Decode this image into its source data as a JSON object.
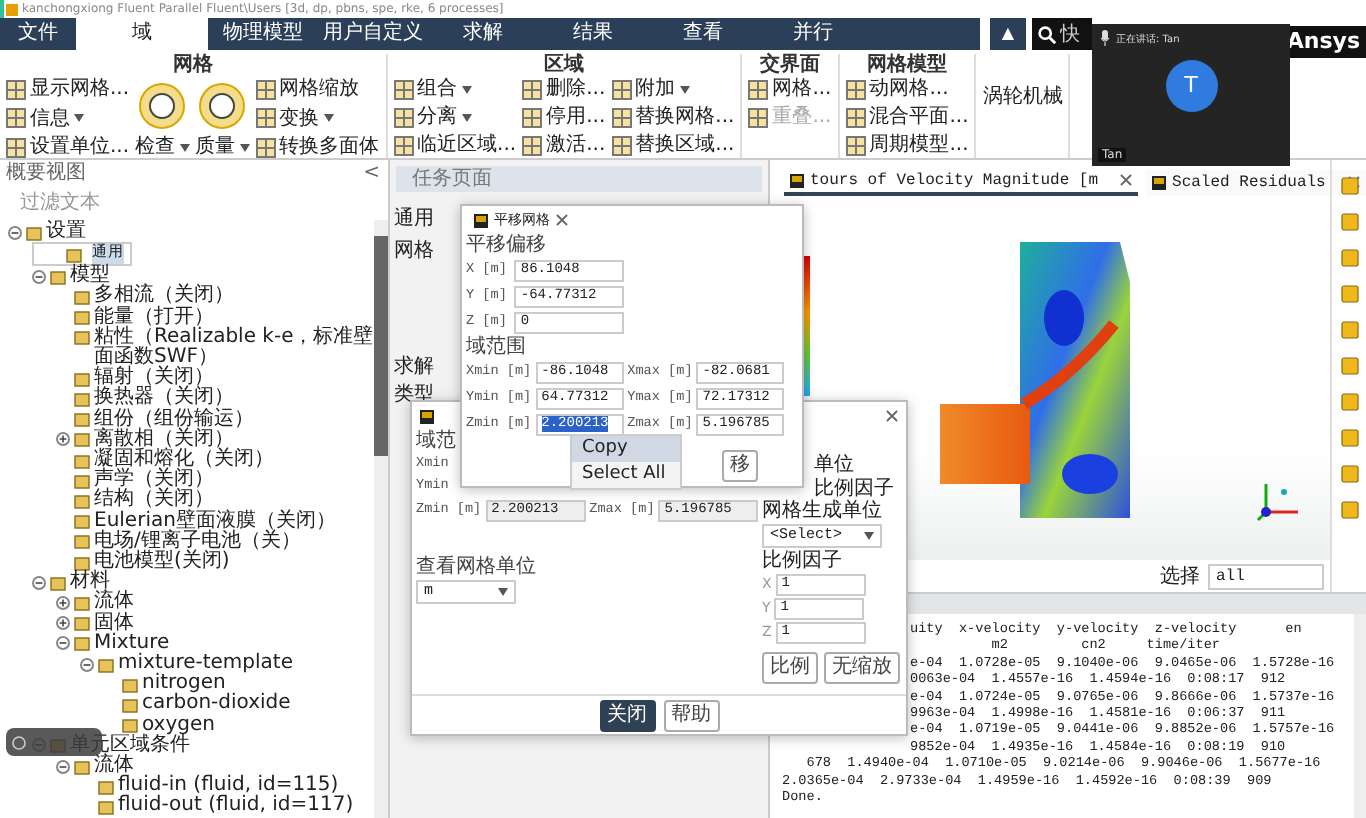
{
  "window": {
    "title": "kanchongxiong Fluent Parallel Fluent\\Users [3d, dp, pbns, spe, rke, 6 processes]"
  },
  "ribbon_tabs": [
    {
      "label": "文件",
      "kind": "file",
      "selected": false
    },
    {
      "label": "域",
      "kind": "tab",
      "selected": true
    },
    {
      "label": "物理模型",
      "kind": "tab",
      "selected": false
    },
    {
      "label": "用户自定义",
      "kind": "tab",
      "selected": false
    },
    {
      "label": "求解",
      "kind": "tab",
      "selected": false
    },
    {
      "label": "结果",
      "kind": "tab",
      "selected": false
    },
    {
      "label": "查看",
      "kind": "tab",
      "selected": false
    },
    {
      "label": "并行",
      "kind": "tab",
      "selected": false
    }
  ],
  "ribbon_collapse": "▲",
  "search": {
    "placeholder": "快"
  },
  "ribbon_groups": [
    {
      "title": "网格",
      "columns": [
        [
          {
            "label": "显示网格...",
            "kind": "small"
          },
          {
            "label": "信息",
            "kind": "small",
            "dropdown": true
          },
          {
            "label": "设置单位...",
            "kind": "small"
          }
        ],
        [
          {
            "label": "检查",
            "kind": "large",
            "dropdown": true
          }
        ],
        [
          {
            "label": "质量",
            "kind": "large",
            "dropdown": true
          }
        ],
        [
          {
            "label": "网格缩放",
            "kind": "small"
          },
          {
            "label": "变换",
            "kind": "small",
            "dropdown": true
          },
          {
            "label": "转换多面体",
            "kind": "small"
          }
        ]
      ]
    },
    {
      "title": "区域",
      "columns": [
        [
          {
            "label": "组合",
            "kind": "small",
            "dropdown": true
          },
          {
            "label": "分离",
            "kind": "small",
            "dropdown": true
          },
          {
            "label": "临近区域...",
            "kind": "small"
          }
        ],
        [
          {
            "label": "删除...",
            "kind": "small"
          },
          {
            "label": "停用...",
            "kind": "small"
          },
          {
            "label": "激活...",
            "kind": "small"
          }
        ],
        [
          {
            "label": "附加",
            "kind": "small",
            "dropdown": true
          },
          {
            "label": "替换网格...",
            "kind": "small"
          },
          {
            "label": "替换区域...",
            "kind": "small"
          }
        ]
      ]
    },
    {
      "title": "交界面",
      "columns": [
        [
          {
            "label": "网格...",
            "kind": "small"
          },
          {
            "label": "重叠...",
            "kind": "small",
            "disabled": true
          }
        ]
      ]
    },
    {
      "title": "网格模型",
      "columns": [
        [
          {
            "label": "动网格...",
            "kind": "small"
          },
          {
            "label": "混合平面...",
            "kind": "small"
          },
          {
            "label": "周期模型...",
            "kind": "small"
          }
        ]
      ]
    },
    {
      "columns": [
        [
          {
            "label": "涡轮机械",
            "kind": "text"
          }
        ]
      ]
    }
  ],
  "logo": "Ansys",
  "meeting": {
    "speaker": "正在讲话: Tan",
    "avatar": "T",
    "name": "Tan"
  },
  "outline": {
    "title": "概要视图",
    "collapse": "<",
    "filter": {
      "placeholder": "过滤文本"
    },
    "tree": [
      {
        "label": "设置",
        "expanded": true,
        "selected": false,
        "children": [
          {
            "label": "通用",
            "selected": true
          },
          {
            "label": "模型",
            "expanded": true,
            "selected": false,
            "children": [
              {
                "label": "多相流（关闭）",
                "selected": false
              },
              {
                "label": "能量（打开）",
                "selected": false
              },
              {
                "label": "粘性（Realizable k-e，标准壁面函数SWF）",
                "selected": false
              },
              {
                "label": "辐射（关闭）",
                "selected": false
              },
              {
                "label": "换热器（关闭）",
                "selected": false
              },
              {
                "label": "组份（组份输运）",
                "selected": false
              },
              {
                "label": "离散相（关闭）",
                "expanded": false,
                "selected": false
              },
              {
                "label": "凝固和熔化（关闭）",
                "selected": false
              },
              {
                "label": "声学（关闭）",
                "selected": false
              },
              {
                "label": "结构（关闭）",
                "selected": false
              },
              {
                "label": "Eulerian壁面液膜（关闭）",
                "selected": false
              },
              {
                "label": "电场/锂离子电池（关）",
                "selected": false
              },
              {
                "label": "电池模型(关闭)",
                "selected": false
              }
            ]
          },
          {
            "label": "材料",
            "expanded": true,
            "selected": false,
            "children": [
              {
                "label": "流体",
                "expanded": false,
                "selected": false
              },
              {
                "label": "固体",
                "expanded": false,
                "selected": false
              },
              {
                "label": "Mixture",
                "expanded": true,
                "selected": false,
                "children": [
                  {
                    "label": "mixture-template",
                    "expanded": true,
                    "selected": false,
                    "children": [
                      {
                        "label": "nitrogen",
                        "selected": false
                      },
                      {
                        "label": "carbon-dioxide",
                        "selected": false
                      },
                      {
                        "label": "oxygen",
                        "selected": false
                      }
                    ]
                  }
                ]
              }
            ]
          },
          {
            "label": "单元区域条件",
            "expanded": true,
            "selected": false,
            "children": [
              {
                "label": "流体",
                "expanded": true,
                "selected": false,
                "children": [
                  {
                    "label": "fluid-in (fluid, id=115)",
                    "selected": false
                  },
                  {
                    "label": "fluid-out (fluid, id=117)",
                    "selected": false
                  }
                ]
              }
            ]
          }
        ]
      }
    ]
  },
  "task_page": {
    "title": "任务页面",
    "labels": [
      "通用",
      "网格",
      "求解",
      "类型"
    ]
  },
  "graphics_tabs": [
    {
      "label": "tours of Velocity Magnitude [m",
      "selected": true
    },
    {
      "label": "Scaled Residuals",
      "selected": false
    }
  ],
  "graphics_select": {
    "label": "选择",
    "value": "all"
  },
  "console": {
    "lines": [
      {
        "kind": "clipped",
        "text": "uity  x-velocity  y-velocity  z-velocity      en"
      },
      {
        "kind": "clipped",
        "text": "          m2         cn2     time/iter"
      },
      {
        "kind": "clipped",
        "text": "e-04  1.0728e-05  9.1040e-06  9.0465e-06  1.5728e-16"
      },
      {
        "kind": "clipped",
        "text": "0063e-04  1.4557e-16  1.4594e-16  0:08:17  912"
      },
      {
        "kind": "clipped",
        "text": "e-04  1.0724e-05  9.0765e-06  9.8666e-06  1.5737e-16"
      },
      {
        "kind": "clipped",
        "text": "9963e-04  1.4998e-16  1.4581e-16  0:06:37  911"
      },
      {
        "kind": "clipped",
        "text": "e-04  1.0719e-05  9.0441e-06  9.8852e-06  1.5757e-16"
      },
      {
        "kind": "clipped",
        "text": "9852e-04  1.4935e-16  1.4584e-16  0:08:19  910"
      },
      {
        "kind": "full",
        "text": "   678  1.4940e-04  1.0710e-05  9.0214e-06  9.9046e-06  1.5677e-16"
      },
      {
        "kind": "full",
        "text": "2.0365e-04  2.9733e-04  1.4959e-16  1.4592e-16  0:08:39  909"
      },
      {
        "kind": "full",
        "text": "Done."
      }
    ]
  },
  "scale_dialog": {
    "range_label": "域范",
    "row_labels": [
      "Xmin",
      "Ymin"
    ],
    "zrow": {
      "min_label": "Zmin [m]",
      "min": "2.200213",
      "max_label": "Zmax [m]",
      "max": "5.196785"
    },
    "view_units": {
      "label": "查看网格单位",
      "value": "m"
    },
    "right": {
      "line1": "单位",
      "line2": "比例因子",
      "mesh_units": "网格生成单位",
      "mesh_units_value": "<Select>",
      "factor_label": "比例因子",
      "factors": [
        {
          "axis": "X",
          "value": "1"
        },
        {
          "axis": "Y",
          "value": "1"
        },
        {
          "axis": "Z",
          "value": "1"
        }
      ],
      "buttons": [
        "比例",
        "无缩放"
      ]
    },
    "buttons": [
      {
        "label": "关闭",
        "kind": "primary"
      },
      {
        "label": "帮助",
        "kind": "normal"
      }
    ]
  },
  "translate_dialog": {
    "title": "平移网格",
    "offset_label": "平移偏移",
    "offsets": [
      {
        "label": "X [m]",
        "value": "86.1048"
      },
      {
        "label": "Y [m]",
        "value": "-64.77312"
      },
      {
        "label": "Z [m]",
        "value": "0"
      }
    ],
    "range_label": "域范围",
    "ranges": [
      {
        "min_label": "Xmin [m]",
        "min": "-86.1048",
        "max_label": "Xmax [m]",
        "max": "-82.0681",
        "selected": false
      },
      {
        "min_label": "Ymin [m]",
        "min": "64.77312",
        "max_label": "Ymax [m]",
        "max": "72.17312",
        "selected": false
      },
      {
        "min_label": "Zmin [m]",
        "min": "2.200213",
        "max_label": "Zmax [m]",
        "max": "5.196785",
        "selected": true
      }
    ],
    "button": "移"
  },
  "context_menu": [
    {
      "label": "Copy",
      "selected": true
    },
    {
      "label": "Select All",
      "selected": false
    }
  ]
}
